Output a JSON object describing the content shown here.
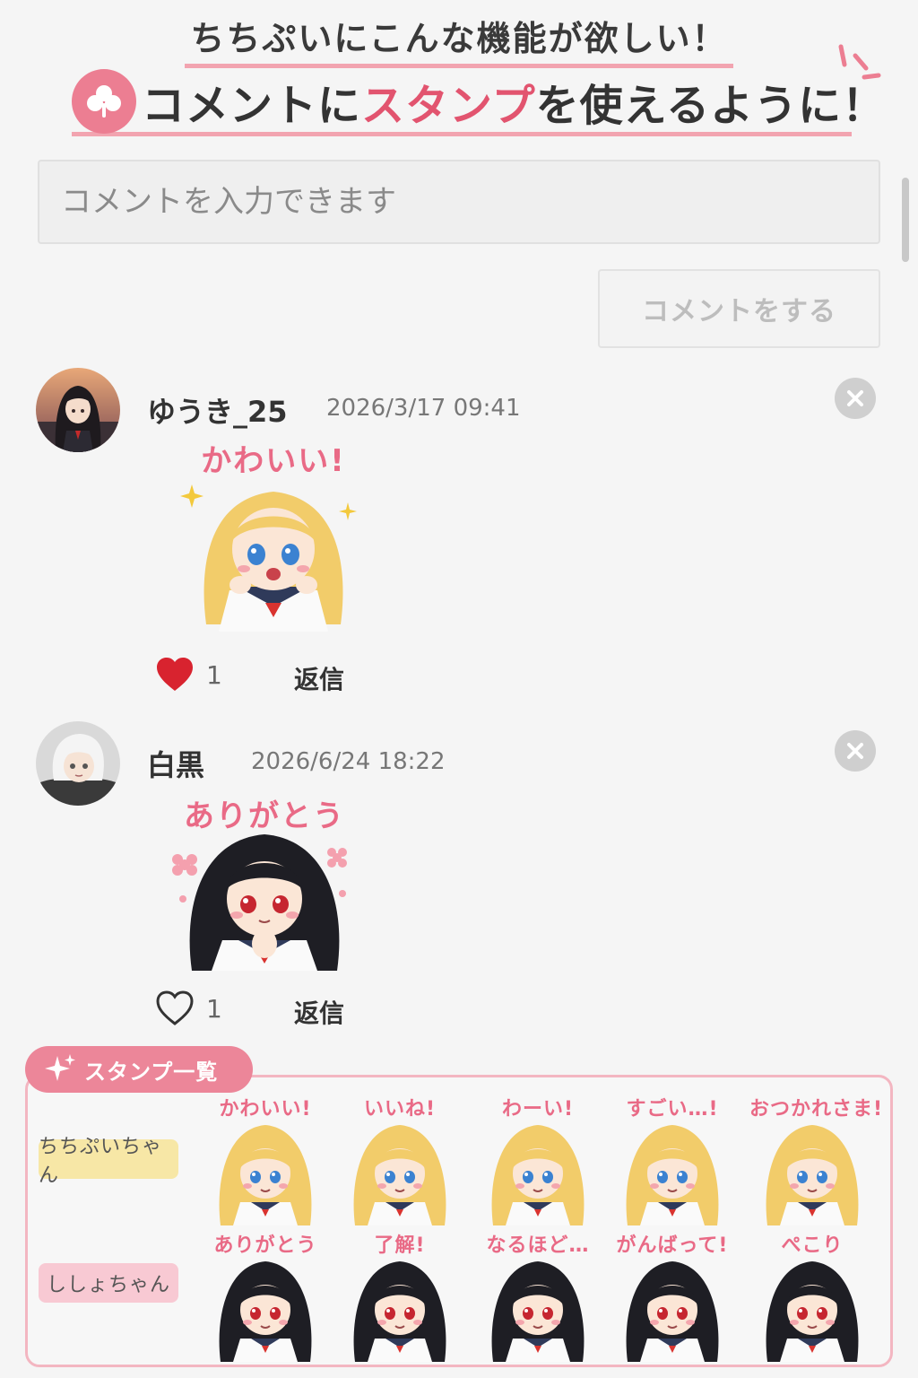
{
  "header": {
    "line1": "ちちぷいにこんな機能が欲しい！",
    "line2_part1": "コメントに",
    "line2_highlight": "スタンプ",
    "line2_part2": "を使えるように！"
  },
  "comment_form": {
    "placeholder": "コメントを入力できます",
    "submit_label": "コメントをする"
  },
  "comments": [
    {
      "username": "ゆうき_25",
      "timestamp": "2026/3/17 09:41",
      "stamp_caption": "かわいい!",
      "likes": "1",
      "liked": true,
      "reply_label": "返信"
    },
    {
      "username": "白黒",
      "timestamp": "2026/6/24 18:22",
      "stamp_caption": "ありがとう",
      "likes": "1",
      "liked": false,
      "reply_label": "返信"
    }
  ],
  "stamp_list": {
    "title": "スタンプ一覧",
    "rows": [
      {
        "character": "ちちぷいちゃん",
        "stamps": [
          "かわいい!",
          "いいね!",
          "わーい!",
          "すごい…!",
          "おつかれさま!"
        ]
      },
      {
        "character": "ししょちゃん",
        "stamps": [
          "ありがとう",
          "了解!",
          "なるほど…",
          "がんばって!",
          "ぺこり"
        ]
      }
    ]
  },
  "colors": {
    "accent_pink": "#e2546f",
    "caption_pink": "#e96a86",
    "underline_pink": "#f2a4b0",
    "heart_red": "#d8232f",
    "blonde_hair": "#f2cc6a",
    "black_hair": "#1e1e24"
  }
}
